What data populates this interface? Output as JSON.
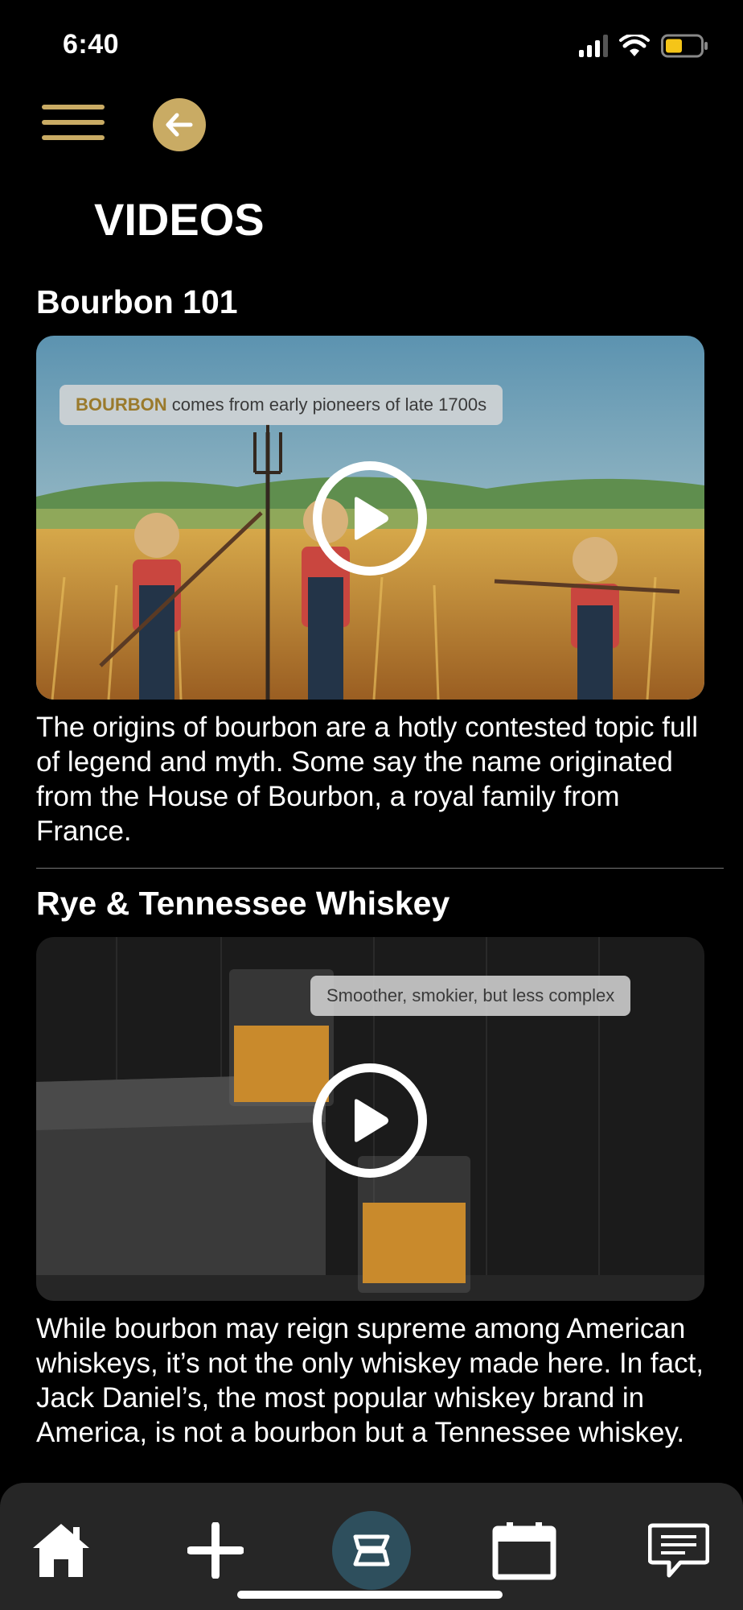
{
  "status_bar": {
    "time": "6:40"
  },
  "header": {
    "title": "VIDEOS"
  },
  "videos": [
    {
      "title": "Bourbon 101",
      "caption_highlight": "BOURBON",
      "caption_rest": " comes from early pioneers of late 1700s",
      "description": " The origins of bourbon are a hotly contested topic full of legend and myth. Some say the name originated from the House of Bourbon, a royal family from France."
    },
    {
      "title": "Rye & Tennessee Whiskey",
      "caption": "Smoother, smokier, but less complex",
      "description": "While bourbon may reign supreme among American whiskeys, it’s not the only whiskey made here. In fact, Jack Daniel’s, the most popular whiskey brand in America, is not a bourbon but a Tennessee whiskey."
    }
  ],
  "tab_bar": {
    "items": [
      {
        "icon": "home-icon"
      },
      {
        "icon": "plus-icon"
      },
      {
        "icon": "logo-icon",
        "active": true
      },
      {
        "icon": "calendar-icon"
      },
      {
        "icon": "chat-icon"
      }
    ]
  },
  "colors": {
    "accent": "#c9ab64",
    "active_tab": "#2e4f5d",
    "tabbar_bg": "#262626"
  }
}
